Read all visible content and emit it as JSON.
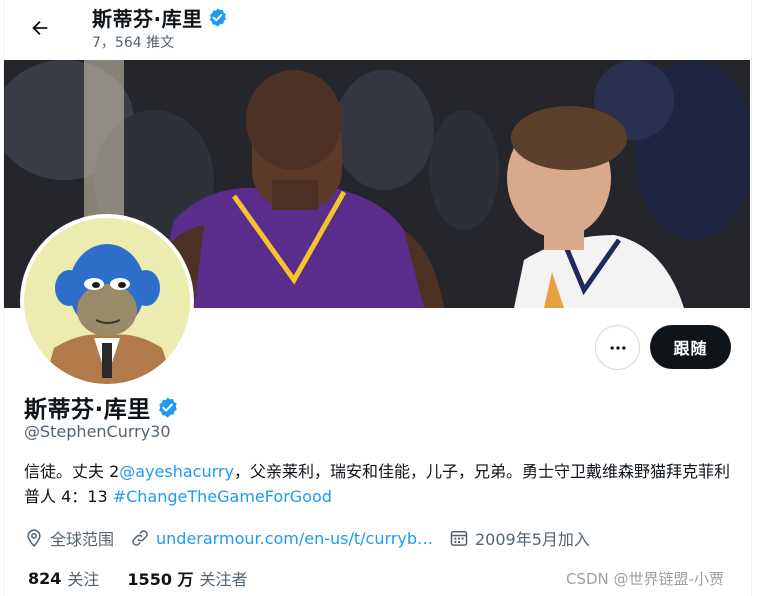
{
  "header": {
    "title": "斯蒂芬·库里",
    "tweet_count": "7，564 推文"
  },
  "profile": {
    "name": "斯蒂芬·库里",
    "handle": "@StephenCurry30",
    "bio_part1": "信徒。丈夫 2",
    "bio_mention": "@ayeshacurry",
    "bio_part2": "，父亲莱利，瑞安和佳能，儿子，兄弟。勇士守卫戴维森野猫拜克菲利普人 4：13 ",
    "bio_hashtag": "#ChangeTheGameForGood",
    "location": "全球范围",
    "website": "underarmour.com/en-us/t/curryb…",
    "joined": "2009年5月加入",
    "following_count": "824",
    "following_label": "关注",
    "followers_count": "1550 万",
    "followers_label": "关注者"
  },
  "actions": {
    "follow_label": "跟随"
  },
  "watermark": "CSDN @世界链盟-小贾",
  "colors": {
    "accent": "#1d9bf0",
    "text": "#0f1419",
    "muted": "#536471",
    "button_dark": "#0f1419",
    "verified": "#1d9bf0"
  },
  "icons": {
    "back": "back-arrow-icon",
    "verified": "verified-badge-icon",
    "more": "more-dots-icon",
    "location": "location-pin-icon",
    "link": "link-icon",
    "calendar": "calendar-icon"
  }
}
